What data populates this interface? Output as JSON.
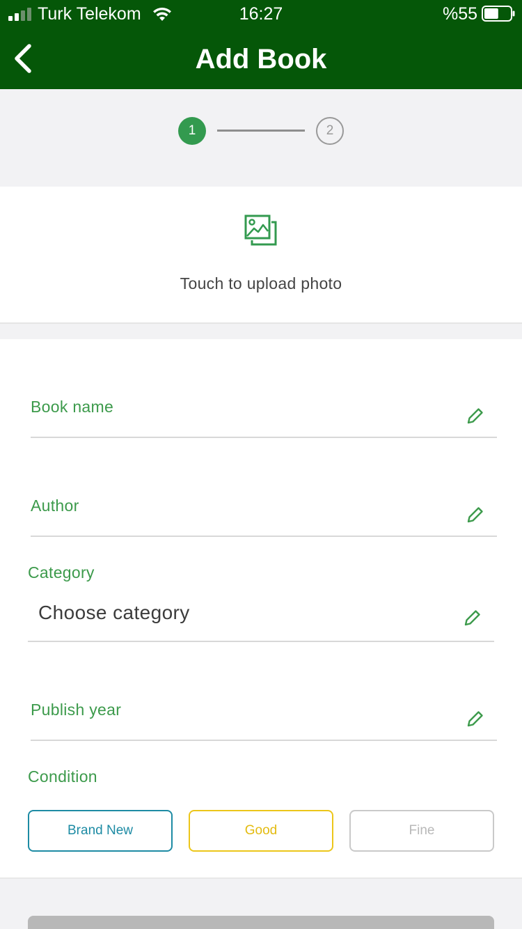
{
  "status_bar": {
    "carrier": "Turk Telekom",
    "time": "16:27",
    "battery": "%55",
    "battery_level": 0.55
  },
  "header": {
    "title": "Add Book",
    "background_color": "#055708"
  },
  "stepper": {
    "steps": [
      "1",
      "2"
    ],
    "active_step": 1,
    "active_color": "#339a4f"
  },
  "upload": {
    "label": "Touch to upload photo"
  },
  "form": {
    "accent_color": "#3c9a4b",
    "book_name": {
      "label": "Book name",
      "value": ""
    },
    "author": {
      "label": "Author",
      "value": ""
    },
    "category": {
      "label": "Category",
      "value": "Choose category"
    },
    "publish_year": {
      "label": "Publish year",
      "value": ""
    },
    "condition": {
      "label": "Condition",
      "options": [
        {
          "label": "Brand New",
          "color": "#1d8ba4"
        },
        {
          "label": "Good",
          "color": "#e3bb10"
        },
        {
          "label": "Fine",
          "color": "#b8b8b8"
        }
      ]
    }
  }
}
